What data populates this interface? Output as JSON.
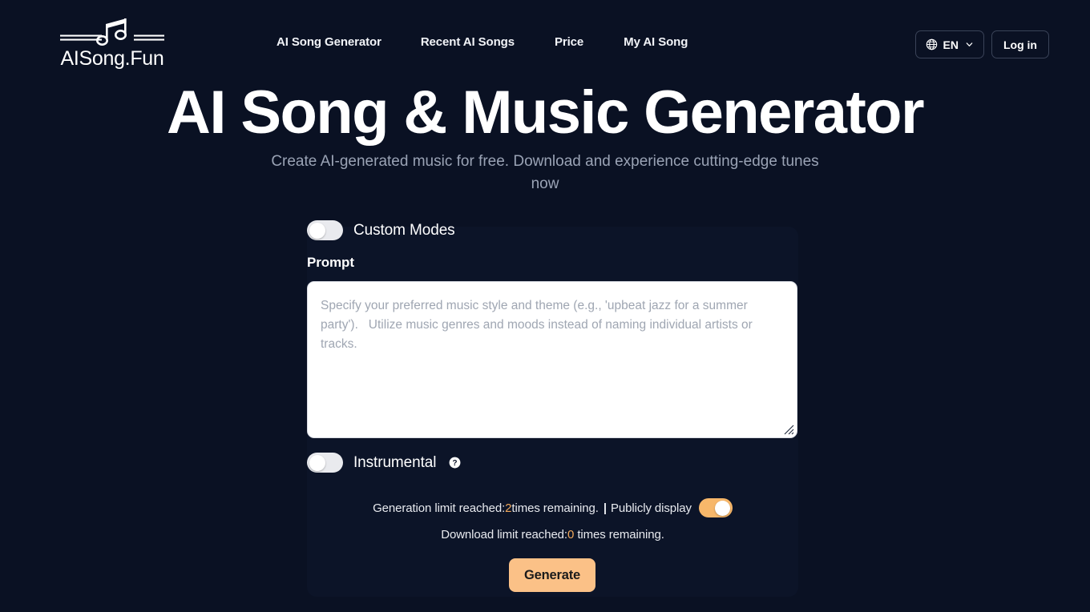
{
  "brand": {
    "name": "AISong.Fun",
    "logo_icon": "music-note-logo-icon"
  },
  "nav": {
    "items": [
      {
        "label": "AI Song Generator"
      },
      {
        "label": "Recent AI Songs"
      },
      {
        "label": "Price"
      },
      {
        "label": "My AI Song"
      }
    ]
  },
  "header_right": {
    "language": {
      "label": "EN",
      "globe_icon": "globe-icon",
      "chevron_icon": "chevron-down-icon"
    },
    "login_label": "Log in"
  },
  "hero": {
    "title": "AI Song & Music Generator",
    "subtitle": "Create AI-generated music for free. Download and experience cutting-edge tunes now"
  },
  "form": {
    "custom_modes": {
      "label": "Custom Modes",
      "state": "off"
    },
    "prompt": {
      "label": "Prompt",
      "value": "",
      "placeholder": "Specify your preferred music style and theme (e.g., 'upbeat jazz for a summer party').   Utilize music genres and moods instead of naming individual artists or tracks."
    },
    "instrumental": {
      "label": "Instrumental",
      "state": "off",
      "help_icon": "question-mark-help-icon"
    },
    "generation_limit": {
      "prefix": "Generation limit reached: ",
      "count": "2",
      "suffix": " times remaining.",
      "separator": "|"
    },
    "publicly_display": {
      "label": "Publicly display",
      "state": "on"
    },
    "download_limit": {
      "prefix": "Download limit reached:",
      "count": "0",
      "suffix": " times remaining."
    },
    "generate_label": "Generate"
  },
  "colors": {
    "page_background": "#0a1123",
    "card_background": "#0c1428",
    "accent_orange": "#fbc187",
    "accent_amber_text": "#f0a75a",
    "text_primary": "#ffffff",
    "text_muted": "#9aa3b5",
    "border_subtle": "#3a4358"
  }
}
